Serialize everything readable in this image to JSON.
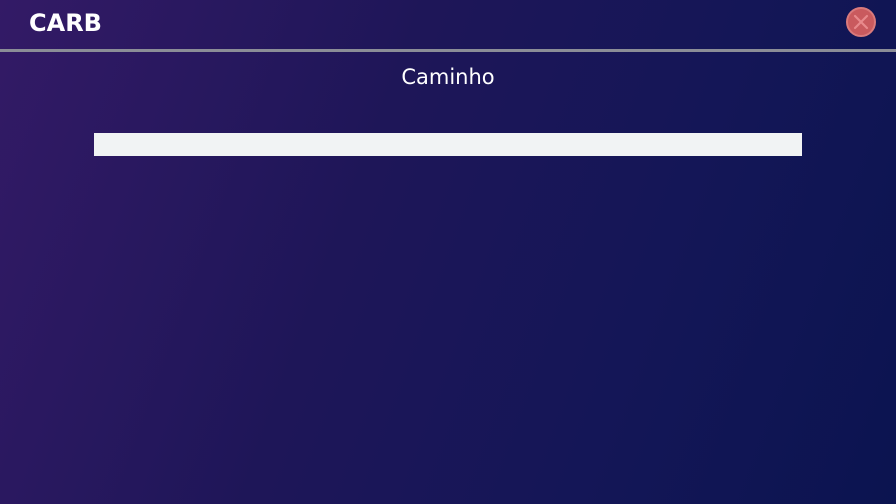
{
  "header": {
    "title": "CARB",
    "close_icon": "close-icon",
    "close_color": "#c95a5e"
  },
  "main": {
    "section_title": "Caminho",
    "path_input": {
      "value": "",
      "placeholder": ""
    }
  },
  "colors": {
    "background_start": "#331a66",
    "background_end": "#0b1450",
    "divider": "#8b8d97",
    "input_background": "#f1f3f4"
  }
}
